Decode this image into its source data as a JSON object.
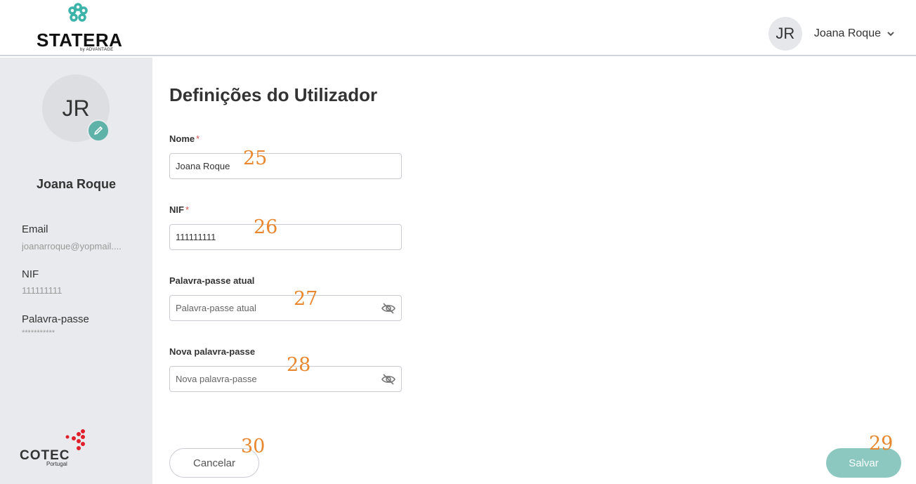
{
  "header": {
    "logo_text": "STATERA",
    "logo_by": "by ADVANTAGE",
    "user_initials": "JR",
    "user_name": "Joana Roque"
  },
  "sidebar": {
    "avatar_initials": "JR",
    "name": "Joana Roque",
    "email_label": "Email",
    "email_value": "joanarroque@yopmail....",
    "nif_label": "NIF",
    "nif_value": "111111111",
    "password_label": "Palavra-passe",
    "password_value": "***********",
    "partner_logo": "COTEC",
    "partner_sub": "Portugal"
  },
  "main": {
    "title": "Definições do Utilizador",
    "fields": {
      "nome": {
        "label": "Nome",
        "required_mark": "*",
        "value": "Joana Roque"
      },
      "nif": {
        "label": "NIF",
        "required_mark": "*",
        "value": "111111111"
      },
      "current_password": {
        "label": "Palavra-passe atual",
        "placeholder": "Palavra-passe atual"
      },
      "new_password": {
        "label": "Nova palavra-passe",
        "placeholder": "Nova palavra-passe"
      }
    },
    "cancel_label": "Cancelar",
    "save_label": "Salvar"
  },
  "annotations": {
    "a25": "25",
    "a26": "26",
    "a27": "27",
    "a28": "28",
    "a29": "29",
    "a30": "30"
  },
  "icons": {
    "brand_mark": "flower-logo-icon",
    "edit": "pencil-icon",
    "chevron": "chevron-down-icon",
    "eye_off": "eye-off-icon"
  },
  "colors": {
    "accent": "#5eb2a8",
    "save_button": "#8cc8c0",
    "annotation": "#e8872e",
    "required": "#d9534f",
    "cotec_red": "#e0202b"
  }
}
